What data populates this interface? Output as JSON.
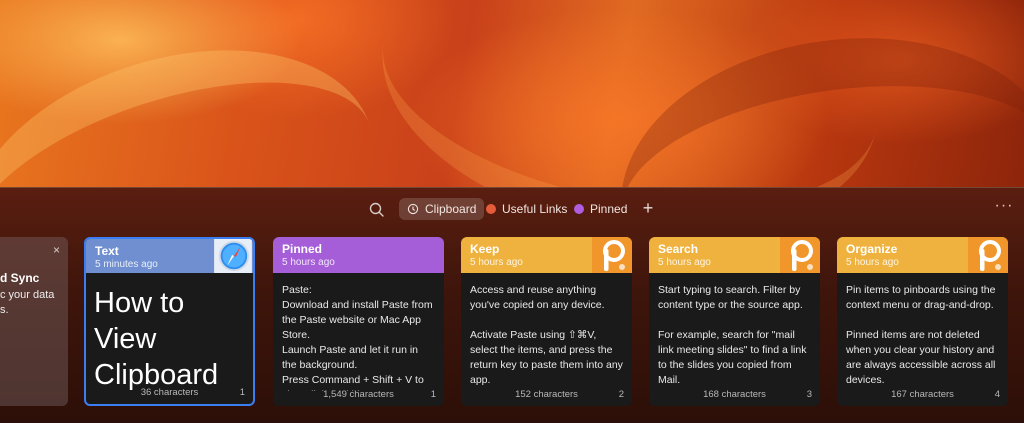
{
  "toolbar": {
    "tabs": [
      {
        "label": "Clipboard",
        "icon": "history-icon",
        "active": true
      },
      {
        "label": "Useful Links",
        "color": "#e45c3a"
      },
      {
        "label": "Pinned",
        "color": "#b05de0"
      }
    ],
    "add_label": "+",
    "more_label": "···"
  },
  "partial_card": {
    "title": "d Sync",
    "line1": "c your data",
    "line2": "s.",
    "close": "×"
  },
  "cards": [
    {
      "type": "Text",
      "time": "5 minutes ago",
      "body": "How to View Clipboard",
      "footer": "36 characters",
      "index": "1",
      "color": "#6f8fd0",
      "icon": "safari-icon"
    },
    {
      "type": "Pinned",
      "time": "5 hours ago",
      "body_lines": [
        "Paste:",
        "Download and install Paste from the Paste website or Mac App Store.",
        "Launch Paste and let it run in the background.",
        "Press Command + Shift + V to view clipboard history."
      ],
      "footer": "1,549 characters",
      "index": "1",
      "color": "#a55ed8"
    },
    {
      "type": "Keep",
      "time": "5 hours ago",
      "body_lines": [
        "Access and reuse anything you've copied on any device.",
        "",
        "Activate Paste using ⇧⌘V, select the items, and press the return key to paste them into any app."
      ],
      "footer": "152 characters",
      "index": "2",
      "color": "#efb23e",
      "icon": "paste-icon"
    },
    {
      "type": "Search",
      "time": "5 hours ago",
      "body_lines": [
        "Start typing to search. Filter by content type or the source app.",
        "",
        "For example, search for \"mail link meeting slides\" to find a link to the slides you copied from Mail."
      ],
      "footer": "168 characters",
      "index": "3",
      "color": "#efb23e",
      "icon": "paste-icon"
    },
    {
      "type": "Organize",
      "time": "5 hours ago",
      "body_lines": [
        "Pin items to pinboards using the context menu or drag-and-drop.",
        "",
        "Pinned items are not deleted when you clear your history and are always accessible across all devices."
      ],
      "footer": "167 characters",
      "index": "4",
      "color": "#efb23e",
      "icon": "paste-icon"
    }
  ]
}
